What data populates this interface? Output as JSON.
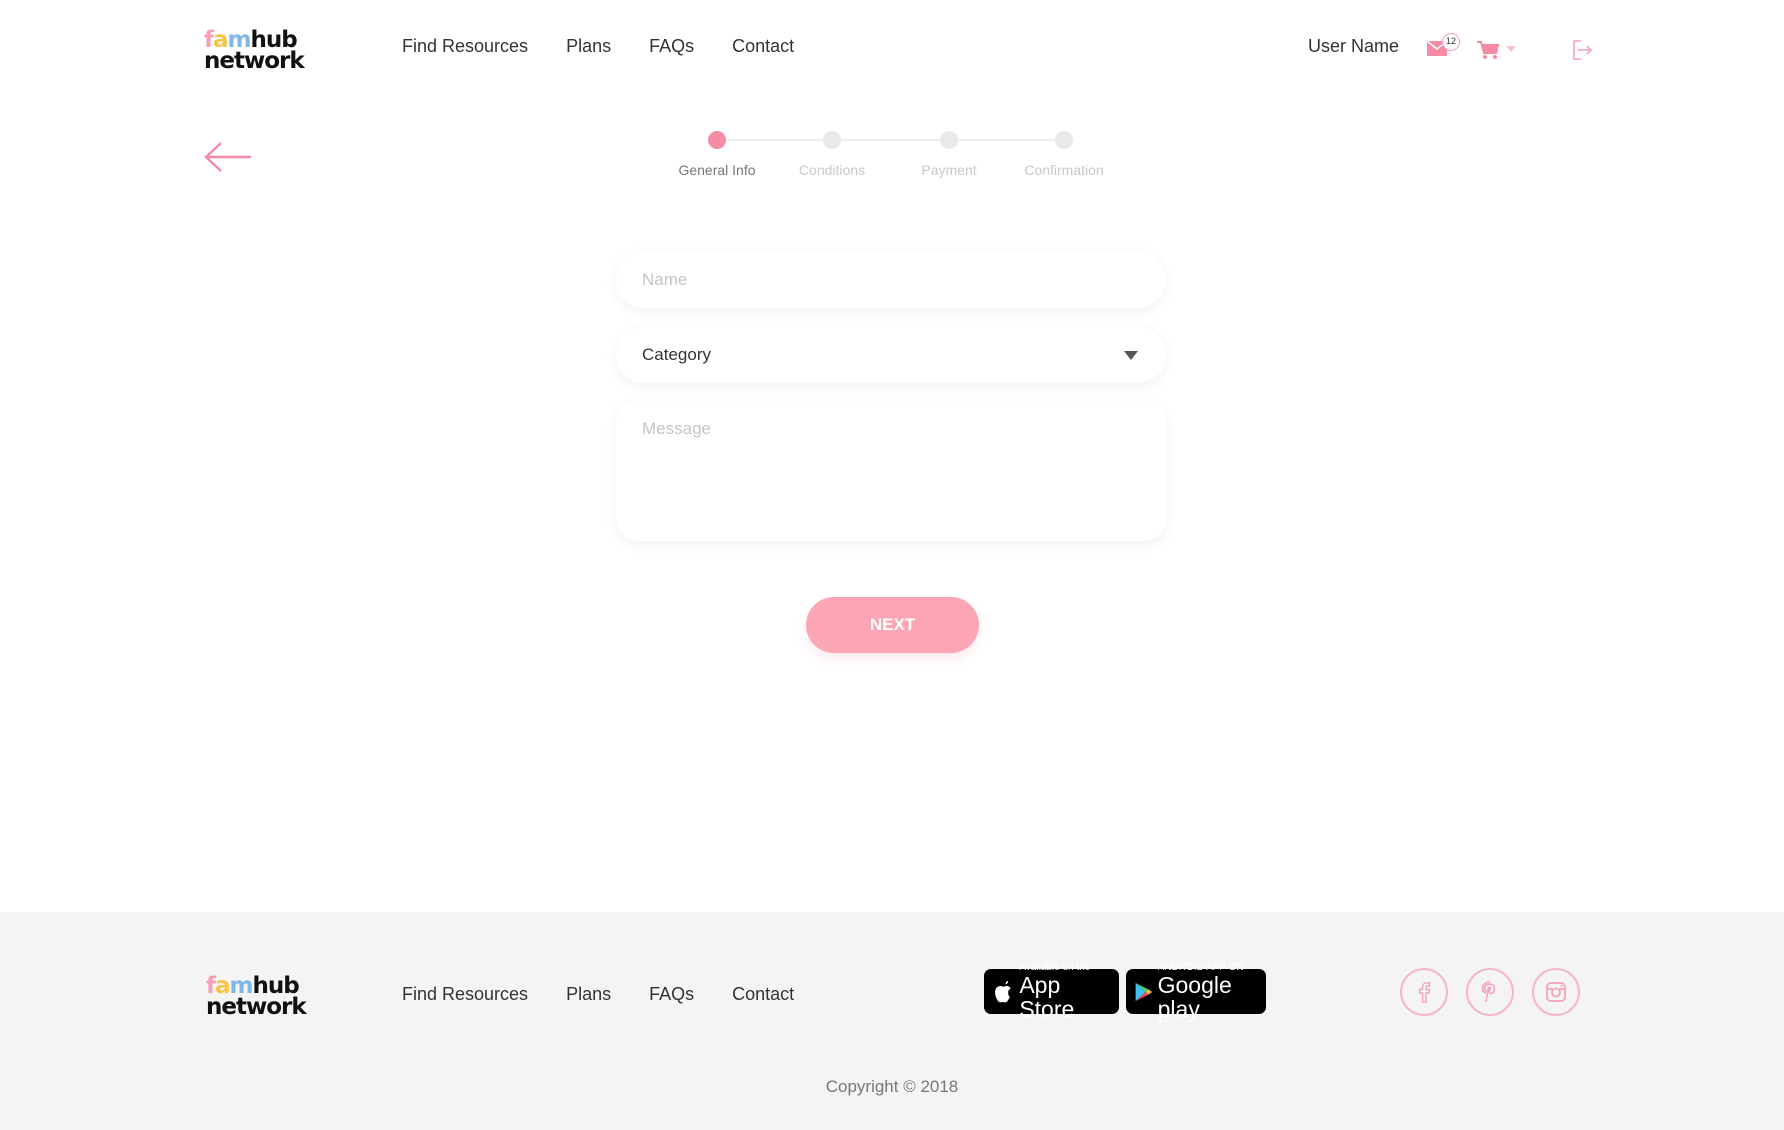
{
  "header": {
    "logo": {
      "line1_parts": [
        "f",
        "a",
        "m",
        "hub"
      ],
      "line2": "network"
    },
    "nav": [
      "Find Resources",
      "Plans",
      "FAQs",
      "Contact"
    ],
    "user_name": "User Name",
    "mail_badge_count": "12"
  },
  "stepper": {
    "steps": [
      "General Info",
      "Conditions",
      "Payment",
      "Confirmation"
    ],
    "active_index": 0
  },
  "form": {
    "name_placeholder": "Name",
    "category_placeholder": "Category",
    "message_placeholder": "Message",
    "next_label": "NEXT"
  },
  "footer": {
    "nav": [
      "Find Resources",
      "Plans",
      "FAQs",
      "Contact"
    ],
    "appstore": {
      "small": "Available on the",
      "big": "App Store"
    },
    "googleplay": {
      "small": "ANDROID APP ON",
      "big": "Google play"
    },
    "social": [
      "facebook-icon",
      "pinterest-icon",
      "instagram-icon"
    ],
    "copyright": "Copyright © 2018"
  },
  "colors": {
    "accent": "#f58ba5",
    "button": "#fba5b5",
    "footer_bg": "#f4f4f4"
  }
}
